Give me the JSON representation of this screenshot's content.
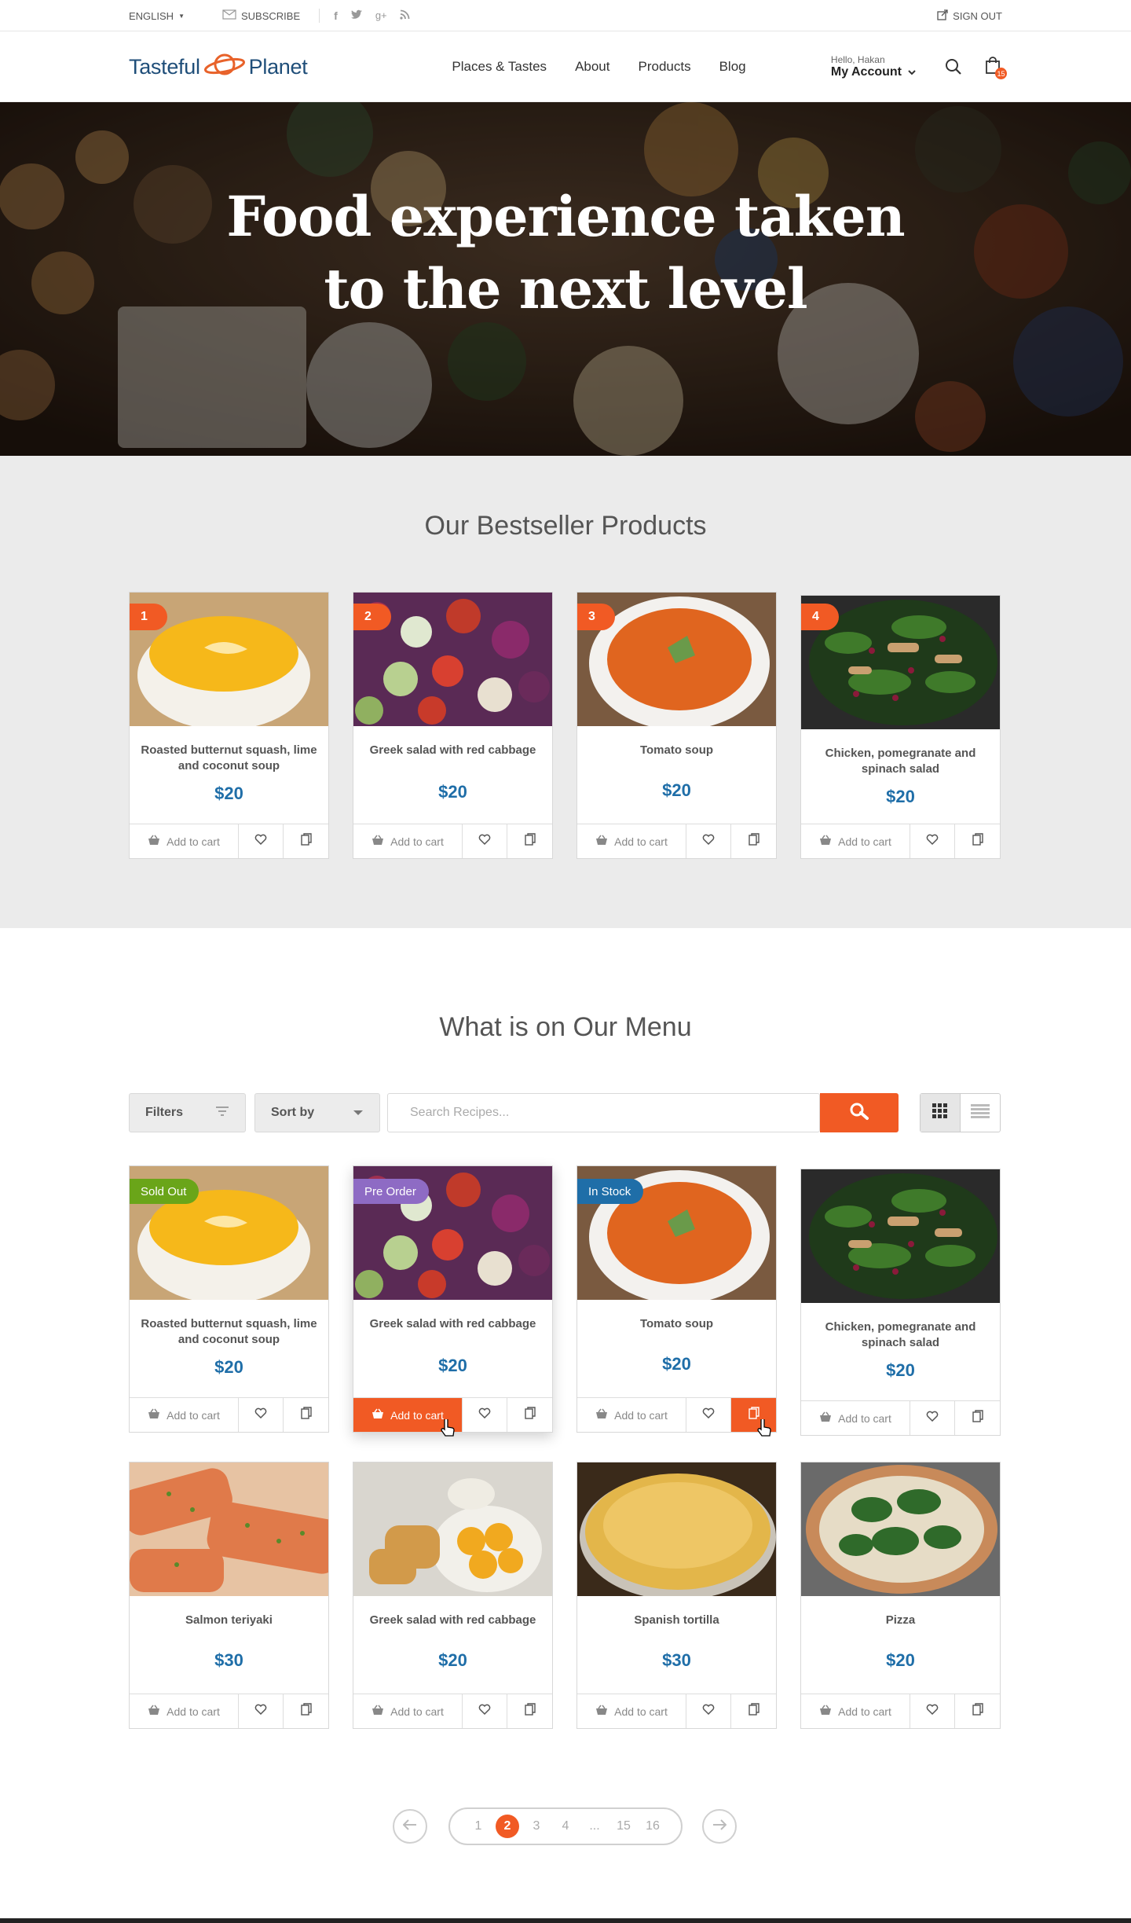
{
  "topbar": {
    "language": "ENGLISH",
    "subscribe": "SUBSCRIBE",
    "social": [
      "facebook-icon",
      "twitter-icon",
      "googleplus-icon",
      "rss-icon"
    ],
    "signout": "SIGN OUT"
  },
  "header": {
    "logo_left": "Tasteful",
    "logo_right": "Planet",
    "nav": [
      "Places & Tastes",
      "About",
      "Products",
      "Blog"
    ],
    "account_greeting": "Hello, Hakan",
    "account_label": "My Account",
    "cart_count": "15"
  },
  "hero": {
    "title_line1": "Food experience taken",
    "title_line2": "to the next level"
  },
  "bestseller": {
    "title": "Our Bestseller Products",
    "add_to_cart": "Add to cart",
    "items": [
      {
        "rank": "1",
        "name_line1": "Roasted butternut squash, lime",
        "name_line2": "and coconut soup",
        "price": "$20"
      },
      {
        "rank": "2",
        "name_line1": "Greek salad with red cabbage",
        "name_line2": "",
        "price": "$20"
      },
      {
        "rank": "3",
        "name_line1": "Tomato soup",
        "name_line2": "",
        "price": "$20"
      },
      {
        "rank": "4",
        "name_line1": "Chicken, pomegranate and",
        "name_line2": "spinach salad",
        "price": "$20"
      }
    ]
  },
  "menu": {
    "title": "What is on Our Menu",
    "filters_label": "Filters",
    "sort_label": "Sort by",
    "search_placeholder": "Search Recipes...",
    "add_to_cart": "Add to cart",
    "row1": [
      {
        "tag": "Sold Out",
        "tag_color": "#6aa519",
        "name_line1": "Roasted butternut squash, lime",
        "name_line2": "and coconut soup",
        "price": "$20"
      },
      {
        "tag": "Pre Order",
        "tag_color": "#8e6bc4",
        "name_line1": "Greek salad with red cabbage",
        "name_line2": "",
        "price": "$20"
      },
      {
        "tag": "In Stock",
        "tag_color": "#1f6ea8",
        "name_line1": "Tomato soup",
        "name_line2": "",
        "price": "$20"
      },
      {
        "tag": "",
        "tag_color": "",
        "name_line1": "Chicken, pomegranate and",
        "name_line2": "spinach salad",
        "price": "$20"
      }
    ],
    "row2": [
      {
        "name": "Salmon teriyaki",
        "price": "$30"
      },
      {
        "name": "Greek salad with red cabbage",
        "price": "$20"
      },
      {
        "name": "Spanish tortilla",
        "price": "$30"
      },
      {
        "name": "Pizza",
        "price": "$20"
      }
    ]
  },
  "pagination": {
    "pages": [
      "1",
      "2",
      "3",
      "4",
      "...",
      "15",
      "16"
    ],
    "current": "2"
  },
  "colors": {
    "accent": "#f15a24",
    "price": "#1f6ea8",
    "brand": "#1f4e79"
  }
}
